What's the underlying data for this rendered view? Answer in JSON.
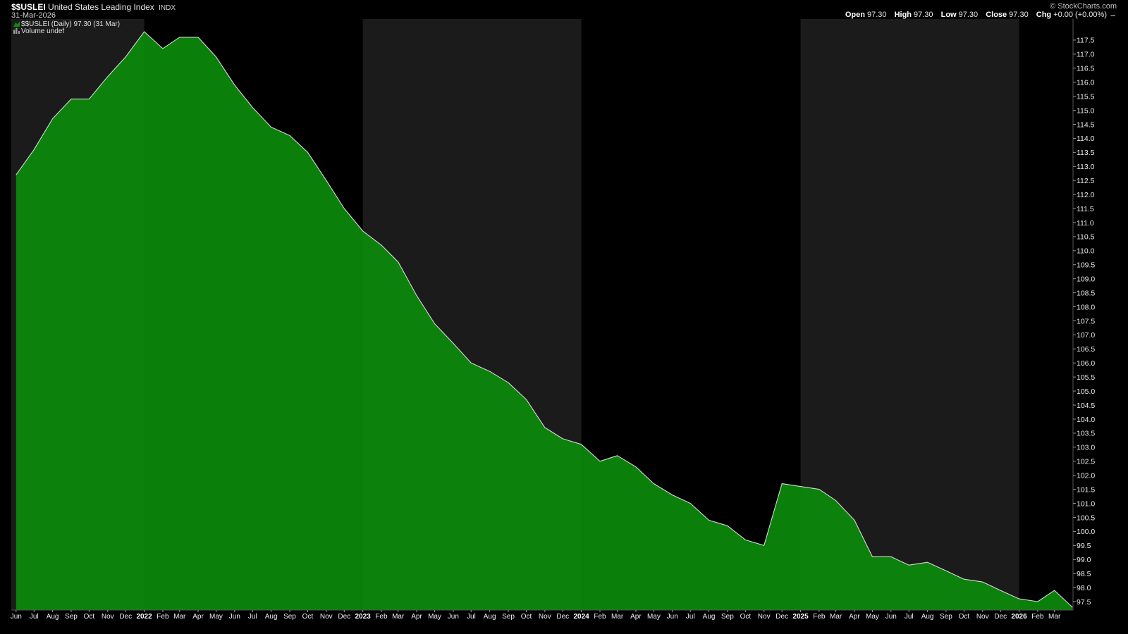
{
  "header": {
    "symbol": "$$USLEI",
    "name": "United States Leading Index",
    "exchange": "INDX",
    "date": "31-Mar-2026",
    "brand": "© StockCharts.com",
    "open_label": "Open",
    "open_value": "97.30",
    "high_label": "High",
    "high_value": "97.30",
    "low_label": "Low",
    "low_value": "97.30",
    "close_label": "Close",
    "close_value": "97.30",
    "chg_label": "Chg",
    "chg_value": "+0.00 (+0.00%)",
    "chg_marker": "–"
  },
  "legend": {
    "series": "$$USLEI (Daily) 97.30 (31 Mar)",
    "volume": "Volume undef"
  },
  "colors": {
    "background": "#000000",
    "alt_band": "#1b1b1b",
    "area_fill": "#0b8a0b",
    "line": "#d8d8d8",
    "tick_text": "#ececec"
  },
  "chart_data": {
    "type": "area",
    "series": [
      {
        "name": "$$USLEI",
        "x": [
          "2021-06-01",
          "2021-07-01",
          "2021-08-01",
          "2021-09-01",
          "2021-10-01",
          "2021-11-01",
          "2021-12-01",
          "2022-01-01",
          "2022-02-01",
          "2022-03-01",
          "2022-04-01",
          "2022-05-01",
          "2022-06-01",
          "2022-07-01",
          "2022-08-01",
          "2022-09-01",
          "2022-10-01",
          "2022-11-01",
          "2022-12-01",
          "2023-01-01",
          "2023-02-01",
          "2023-03-01",
          "2023-04-01",
          "2023-05-01",
          "2023-06-01",
          "2023-07-01",
          "2023-08-01",
          "2023-09-01",
          "2023-10-01",
          "2023-11-01",
          "2023-12-01",
          "2024-01-01",
          "2024-02-01",
          "2024-03-01",
          "2024-04-01",
          "2024-05-01",
          "2024-06-01",
          "2024-07-01",
          "2024-08-01",
          "2024-09-01",
          "2024-10-01",
          "2024-11-01",
          "2024-12-01",
          "2025-01-01",
          "2025-02-01",
          "2025-03-01",
          "2025-04-01",
          "2025-05-01",
          "2025-06-01",
          "2025-07-01",
          "2025-08-01",
          "2025-09-01",
          "2025-10-01",
          "2025-11-01",
          "2025-12-01",
          "2026-01-01",
          "2026-02-01",
          "2026-03-01",
          "2026-03-31"
        ],
        "values": [
          112.7,
          113.6,
          114.7,
          115.4,
          115.4,
          116.2,
          116.9,
          117.8,
          117.2,
          117.6,
          117.6,
          116.9,
          115.9,
          115.1,
          114.4,
          114.1,
          113.5,
          112.5,
          111.5,
          110.7,
          110.2,
          109.6,
          108.4,
          107.4,
          106.7,
          106.0,
          105.7,
          105.3,
          104.7,
          103.7,
          103.3,
          103.1,
          102.5,
          102.7,
          102.3,
          101.7,
          101.3,
          101.0,
          100.4,
          100.2,
          99.7,
          99.5,
          101.7,
          101.6,
          101.5,
          101.1,
          100.4,
          99.1,
          99.1,
          98.8,
          98.9,
          98.6,
          98.3,
          98.2,
          97.9,
          97.6,
          97.5,
          97.9,
          97.3
        ]
      }
    ],
    "x_tick_labels": [
      {
        "date": "2021-06-01",
        "label": "Jun"
      },
      {
        "date": "2021-07-01",
        "label": "Jul"
      },
      {
        "date": "2021-08-01",
        "label": "Aug"
      },
      {
        "date": "2021-09-01",
        "label": "Sep"
      },
      {
        "date": "2021-10-01",
        "label": "Oct"
      },
      {
        "date": "2021-11-01",
        "label": "Nov"
      },
      {
        "date": "2021-12-01",
        "label": "Dec"
      },
      {
        "date": "2022-01-01",
        "label": "2022"
      },
      {
        "date": "2022-02-01",
        "label": "Feb"
      },
      {
        "date": "2022-03-01",
        "label": "Mar"
      },
      {
        "date": "2022-04-01",
        "label": "Apr"
      },
      {
        "date": "2022-05-01",
        "label": "May"
      },
      {
        "date": "2022-06-01",
        "label": "Jun"
      },
      {
        "date": "2022-07-01",
        "label": "Jul"
      },
      {
        "date": "2022-08-01",
        "label": "Aug"
      },
      {
        "date": "2022-09-01",
        "label": "Sep"
      },
      {
        "date": "2022-10-01",
        "label": "Oct"
      },
      {
        "date": "2022-11-01",
        "label": "Nov"
      },
      {
        "date": "2022-12-01",
        "label": "Dec"
      },
      {
        "date": "2023-01-01",
        "label": "2023"
      },
      {
        "date": "2023-02-01",
        "label": "Feb"
      },
      {
        "date": "2023-03-01",
        "label": "Mar"
      },
      {
        "date": "2023-04-01",
        "label": "Apr"
      },
      {
        "date": "2023-05-01",
        "label": "May"
      },
      {
        "date": "2023-06-01",
        "label": "Jun"
      },
      {
        "date": "2023-07-01",
        "label": "Jul"
      },
      {
        "date": "2023-08-01",
        "label": "Aug"
      },
      {
        "date": "2023-09-01",
        "label": "Sep"
      },
      {
        "date": "2023-10-01",
        "label": "Oct"
      },
      {
        "date": "2023-11-01",
        "label": "Nov"
      },
      {
        "date": "2023-12-01",
        "label": "Dec"
      },
      {
        "date": "2024-01-01",
        "label": "2024"
      },
      {
        "date": "2024-02-01",
        "label": "Feb"
      },
      {
        "date": "2024-03-01",
        "label": "Mar"
      },
      {
        "date": "2024-04-01",
        "label": "Apr"
      },
      {
        "date": "2024-05-01",
        "label": "May"
      },
      {
        "date": "2024-06-01",
        "label": "Jun"
      },
      {
        "date": "2024-07-01",
        "label": "Jul"
      },
      {
        "date": "2024-08-01",
        "label": "Aug"
      },
      {
        "date": "2024-09-01",
        "label": "Sep"
      },
      {
        "date": "2024-10-01",
        "label": "Oct"
      },
      {
        "date": "2024-11-01",
        "label": "Nov"
      },
      {
        "date": "2024-12-01",
        "label": "Dec"
      },
      {
        "date": "2025-01-01",
        "label": "2025"
      },
      {
        "date": "2025-02-01",
        "label": "Feb"
      },
      {
        "date": "2025-03-01",
        "label": "Mar"
      },
      {
        "date": "2025-04-01",
        "label": "Apr"
      },
      {
        "date": "2025-05-01",
        "label": "May"
      },
      {
        "date": "2025-06-01",
        "label": "Jun"
      },
      {
        "date": "2025-07-01",
        "label": "Jul"
      },
      {
        "date": "2025-08-01",
        "label": "Aug"
      },
      {
        "date": "2025-09-01",
        "label": "Sep"
      },
      {
        "date": "2025-10-01",
        "label": "Oct"
      },
      {
        "date": "2025-11-01",
        "label": "Nov"
      },
      {
        "date": "2025-12-01",
        "label": "Dec"
      },
      {
        "date": "2026-01-01",
        "label": "2026"
      },
      {
        "date": "2026-02-01",
        "label": "Feb"
      },
      {
        "date": "2026-03-01",
        "label": "Mar"
      }
    ],
    "y_ticks": [
      "97.5",
      "98.0",
      "98.5",
      "99.0",
      "99.5",
      "100.0",
      "100.5",
      "101.0",
      "101.5",
      "102.0",
      "102.5",
      "103.0",
      "103.5",
      "104.0",
      "104.5",
      "105.0",
      "105.5",
      "106.0",
      "106.5",
      "107.0",
      "107.5",
      "108.0",
      "108.5",
      "109.0",
      "109.5",
      "110.0",
      "110.5",
      "111.0",
      "111.5",
      "112.0",
      "112.5",
      "113.0",
      "113.5",
      "114.0",
      "114.5",
      "115.0",
      "115.5",
      "116.0",
      "116.5",
      "117.0",
      "117.5"
    ],
    "y_axis_position": "right",
    "ylim": [
      97.2,
      118.25
    ],
    "xlim": [
      "2021-05-24",
      "2026-04-01"
    ],
    "shaded_years": [
      "2021",
      "2023",
      "2025"
    ],
    "grid": false
  }
}
